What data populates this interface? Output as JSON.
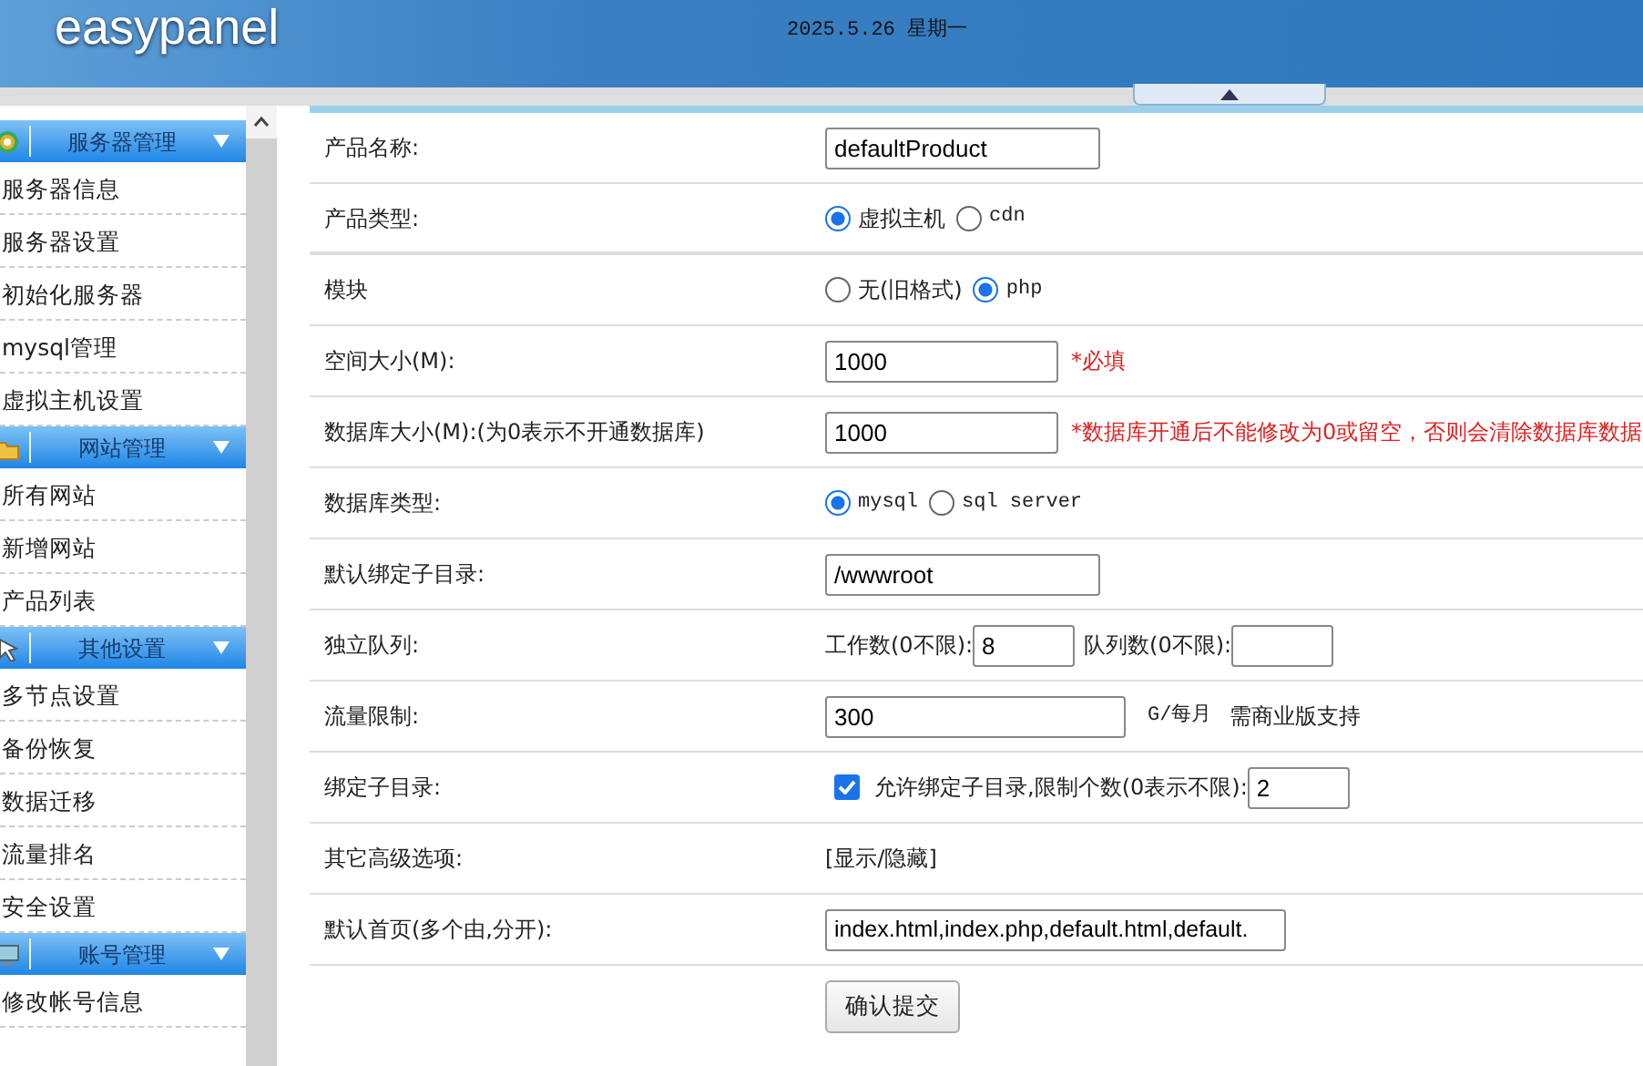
{
  "header": {
    "logo": "easypanel",
    "date": "2025.5.26 星期一"
  },
  "sidebar": {
    "groups": [
      {
        "title": "服务器管理",
        "items": [
          "服务器信息",
          "服务器设置",
          "初始化服务器",
          "mysql管理",
          "虚拟主机设置"
        ]
      },
      {
        "title": "网站管理",
        "items": [
          "所有网站",
          "新增网站",
          "产品列表"
        ]
      },
      {
        "title": "其他设置",
        "items": [
          "多节点设置",
          "备份恢复",
          "数据迁移",
          "流量排名",
          "安全设置"
        ]
      },
      {
        "title": "账号管理",
        "items": [
          "修改帐号信息"
        ]
      }
    ]
  },
  "form": {
    "rows": [
      {
        "kind": "text",
        "label": "产品名称:",
        "value": "defaultProduct"
      },
      {
        "kind": "radio",
        "label": "产品类型:",
        "options": [
          {
            "label": "虚拟主机",
            "selected": true
          },
          {
            "label": "cdn",
            "selected": false
          }
        ]
      },
      {
        "kind": "radio",
        "label": "模块",
        "options": [
          {
            "label": "无(旧格式)",
            "selected": false
          },
          {
            "label": "php",
            "selected": true
          }
        ]
      },
      {
        "kind": "text",
        "label": "空间大小(M):",
        "value": "1000",
        "note": "*必填"
      },
      {
        "kind": "text",
        "label": "数据库大小(M):(为0表示不开通数据库)",
        "value": "1000",
        "note": "*数据库开通后不能修改为0或留空，否则会清除数据库数据"
      },
      {
        "kind": "radio",
        "label": "数据库类型:",
        "options": [
          {
            "label": "mysql",
            "selected": true
          },
          {
            "label": "sql server",
            "selected": false
          }
        ]
      },
      {
        "kind": "text",
        "label": "默认绑定子目录:",
        "value": "/wwwroot"
      },
      {
        "kind": "pair",
        "label": "独立队列:",
        "fields": [
          {
            "label": "工作数(0不限):",
            "value": "8"
          },
          {
            "label": "队列数(0不限):"
          }
        ]
      },
      {
        "kind": "text",
        "label": "流量限制:",
        "value": "300",
        "suffix": "G/每月",
        "extra": "需商业版支持"
      },
      {
        "kind": "checkbox",
        "label": "绑定子目录:",
        "checked": true,
        "text": "允许绑定子目录,限制个数(0表示不限):",
        "value": "2"
      },
      {
        "kind": "link",
        "label": "其它高级选项:",
        "text": "[显示/隐藏]"
      },
      {
        "kind": "text",
        "label": "默认首页(多个由,分开):",
        "value": "index.html,index.php,default.html,default."
      },
      {
        "kind": "submit",
        "button": "确认提交"
      }
    ]
  }
}
